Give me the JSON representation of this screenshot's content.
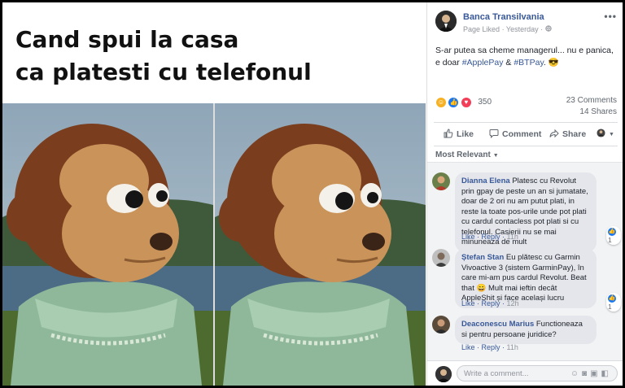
{
  "meme": {
    "caption_line1": "Cand spui la casa",
    "caption_line2": "ca platesti cu telefonul"
  },
  "post": {
    "page_name": "Banca Transilvania",
    "liked": "Page Liked",
    "time": "Yesterday",
    "text_prefix": "S-ar putea sa cheme managerul... nu e panica, e doar ",
    "tag1": "#ApplePay",
    "text_mid": " & ",
    "tag2": "#BTPay",
    "text_suffix": ". 😎",
    "reaction_count": "350",
    "comments_count": "23 Comments",
    "shares_count": "14 Shares",
    "like_label": "Like",
    "comment_label": "Comment",
    "share_label": "Share",
    "sort_label": "Most Relevant"
  },
  "comments": [
    {
      "author": "Dianna Elena",
      "text": "Platesc cu Revolut prin gpay de peste un an si jumatate, doar de 2 ori nu am putut plati, in reste la toate pos-urile unde pot plati cu cardul contacless pot plati si cu telefonul. Casierii nu se mai minuneaza de mult",
      "like": "Like",
      "reply": "Reply",
      "time": "11h",
      "likes": "1"
    },
    {
      "author": "Ștefan Stan",
      "text": "Eu plătesc cu Garmin Vivoactive 3 (sistem GarminPay), în care mi-am pus cardul Revolut. Beat that 😄 Mult mai ieftin decât AppleShit și face același lucru",
      "like": "Like",
      "reply": "Reply",
      "time": "12h",
      "likes": "1"
    },
    {
      "author": "Deaconescu Marius",
      "text": "Functioneaza si pentru persoane juridice?",
      "like": "Like",
      "reply": "Reply",
      "time": "11h"
    }
  ],
  "composer": {
    "placeholder": "Write a comment..."
  },
  "colors": {
    "link": "#385898",
    "muted": "#606770",
    "bubble": "#e4e6eb"
  }
}
